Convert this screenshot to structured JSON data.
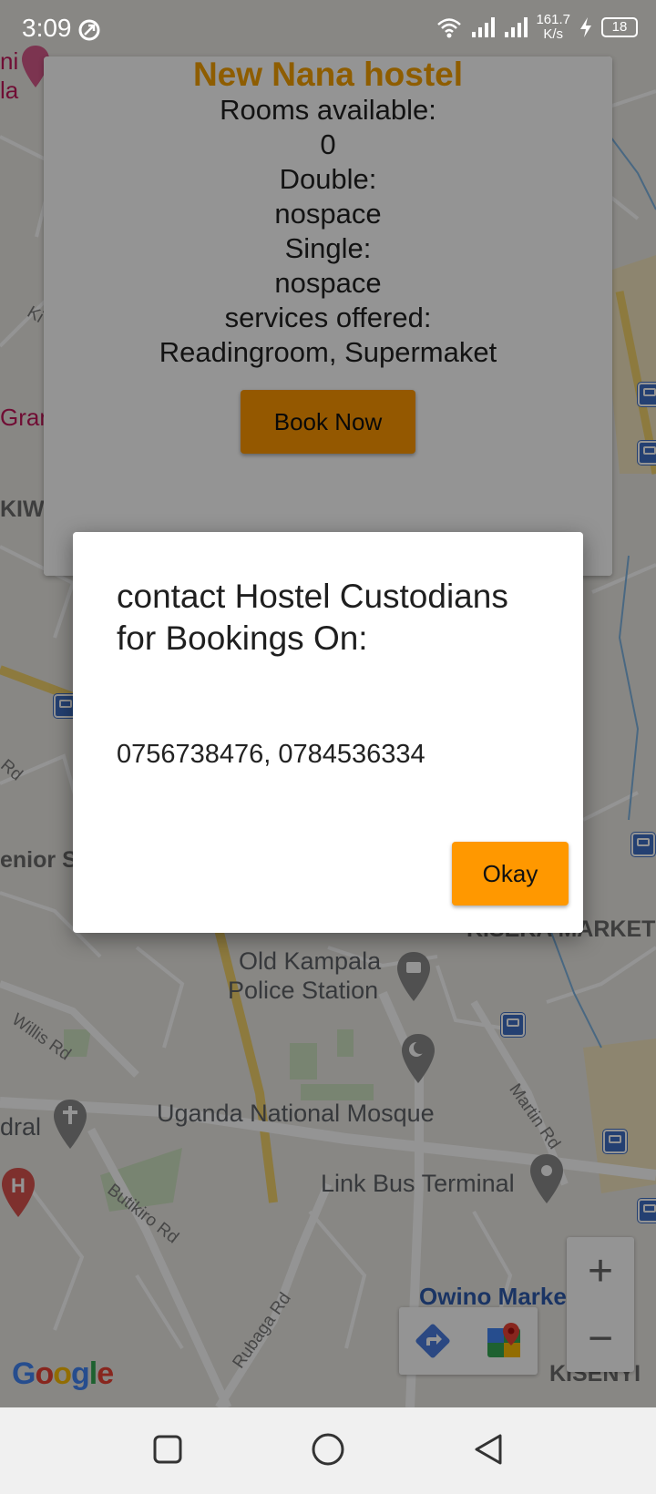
{
  "status_bar": {
    "time": "3:09",
    "net_speed_value": "161.7",
    "net_speed_unit": "K/s",
    "battery": "18"
  },
  "map": {
    "labels": {
      "old_kampala_police_1": "Old Kampala",
      "old_kampala_police_2": "Police Station",
      "national_mosque": "Uganda National Mosque",
      "link_bus_terminal": "Link Bus Terminal",
      "owino_market": "Owino Market",
      "kisenyi": "KISENYI",
      "kisekka_market": "KISEKA MARKET",
      "senior": "enior S",
      "kiwu": "KIWU",
      "gran": "Gran",
      "dral": "dral",
      "ni": "ni",
      "la": "la",
      "willis_rd": "Willis Rd",
      "butikiro_rd": "Butikiro Rd",
      "rubaga_rd": "Rubaga Rd",
      "martin_rd": "Martin Rd",
      "rd_left": "Rd",
      "ki_left": "Ki"
    },
    "google_logo": "Google",
    "zoom_in": "+",
    "zoom_out": "−"
  },
  "hostel_card": {
    "name": "New Nana hostel",
    "rooms_label": "Rooms available:",
    "rooms_value": "0",
    "double_label": "Double:",
    "double_value": "nospace",
    "single_label": "Single:",
    "single_value": "nospace",
    "services_label": "services offered:",
    "services_value": "Readingroom, Supermaket",
    "book_button": "Book Now"
  },
  "dialog": {
    "title": "contact Hostel Custodians for Bookings On:",
    "message": "0756738476, 0784536334",
    "ok_button": "Okay"
  },
  "colors": {
    "accent": "#ff9800",
    "hostel_name": "#f5a000"
  }
}
